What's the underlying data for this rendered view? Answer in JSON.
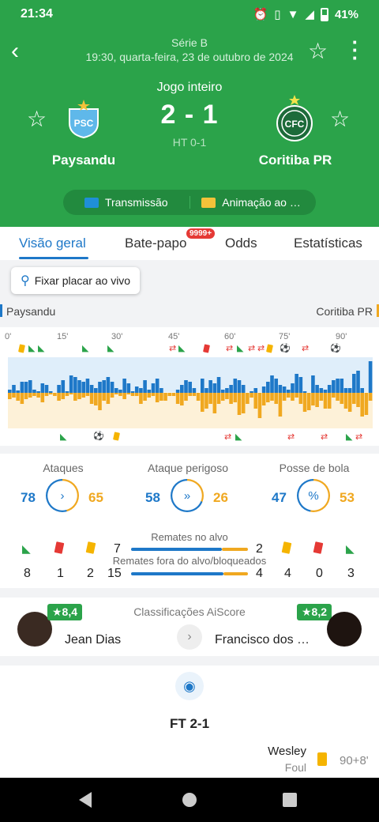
{
  "status_bar": {
    "time": "21:34",
    "battery": "41%"
  },
  "header": {
    "league": "Série B",
    "datetime": "19:30, quarta-feira, 23 de outubro de 2024",
    "period": "Jogo inteiro",
    "score": "2 - 1",
    "halftime": "HT 0-1",
    "home_team": "Paysandu",
    "away_team": "Coritiba PR",
    "home_crest_text": "PSC",
    "away_crest_text": "CFC",
    "buttons": {
      "stream": "Transmissão",
      "animation": "Animação ao vivo"
    }
  },
  "tabs": [
    {
      "label": "Visão geral",
      "active": true
    },
    {
      "label": "Bate-papo",
      "badge": "9999+"
    },
    {
      "label": "Odds"
    },
    {
      "label": "Estatísticas"
    }
  ],
  "pin_button": "Fixar placar ao vivo",
  "sides": {
    "left": "Paysandu",
    "right": "Coritiba PR"
  },
  "timeline": {
    "minute_labels": [
      "0'",
      "15'",
      "30'",
      "45'",
      "60'",
      "75'",
      "90'"
    ],
    "home_pressure": [
      4,
      10,
      3,
      14,
      14,
      16,
      4,
      2,
      12,
      10,
      2,
      0,
      10,
      16,
      2,
      22,
      20,
      16,
      14,
      18,
      10,
      6,
      14,
      16,
      20,
      14,
      6,
      4,
      18,
      12,
      2,
      8,
      6,
      16,
      4,
      12,
      18,
      6,
      0,
      0,
      0,
      4,
      10,
      16,
      14,
      6,
      0,
      18,
      6,
      16,
      12,
      20,
      4,
      6,
      10,
      18,
      16,
      10,
      0,
      2,
      6,
      0,
      8,
      14,
      22,
      18,
      10,
      8,
      4,
      12,
      24,
      20,
      2,
      0,
      22,
      10,
      6,
      4,
      10,
      16,
      18,
      18,
      6,
      6,
      24,
      28,
      6,
      0,
      40
    ],
    "away_pressure": [
      8,
      6,
      10,
      14,
      8,
      6,
      4,
      6,
      12,
      4,
      2,
      4,
      10,
      8,
      4,
      2,
      10,
      8,
      6,
      4,
      14,
      16,
      22,
      10,
      14,
      6,
      2,
      4,
      8,
      2,
      4,
      4,
      14,
      10,
      6,
      4,
      12,
      10,
      10,
      4,
      4,
      14,
      16,
      10,
      4,
      4,
      10,
      24,
      20,
      14,
      26,
      14,
      10,
      8,
      14,
      12,
      28,
      26,
      14,
      6,
      20,
      32,
      16,
      12,
      10,
      14,
      30,
      10,
      6,
      10,
      6,
      14,
      24,
      22,
      16,
      18,
      10,
      20,
      20,
      6,
      10,
      14,
      20,
      24,
      14,
      18,
      30,
      28,
      10
    ]
  },
  "stats": {
    "attacks": {
      "label": "Ataques",
      "home": "78",
      "away": "65",
      "home_share": 0.545
    },
    "dangerous": {
      "label": "Ataque perigoso",
      "home": "58",
      "away": "26",
      "home_share": 0.69
    },
    "possession": {
      "label": "Posse de bola",
      "home": "47",
      "away": "53",
      "home_share": 0.47
    },
    "shots_on": {
      "label": "Remates no alvo",
      "home": "7",
      "away": "2",
      "home_share": 0.78
    },
    "shots_off": {
      "label": "Remates fora do alvo/bloqueados",
      "home": "15",
      "away": "4",
      "home_share": 0.79
    },
    "home_corners": "8",
    "home_red": "1",
    "home_yellow": "2",
    "away_yellow": "4",
    "away_red": "0",
    "away_corners": "3"
  },
  "ratings": {
    "title": "Classificações AiScore",
    "home_player": "Jean Dias",
    "home_rating": "★8,4",
    "away_player": "Francisco dos Santos",
    "away_rating": "★8,2"
  },
  "events": {
    "final": "FT 2-1",
    "last_event": {
      "player": "Wesley",
      "type": "Foul",
      "minute": "90+8'"
    }
  },
  "colors": {
    "header_green": "#2ba34a",
    "home_blue": "#1e78c8",
    "away_orange": "#f0a820"
  }
}
